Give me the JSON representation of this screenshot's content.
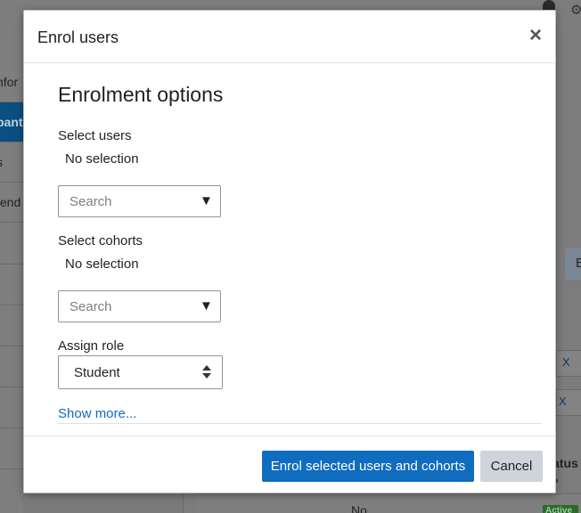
{
  "background": {
    "sidebar": {
      "items": [
        {
          "label": "nfor",
          "active": false
        },
        {
          "label": "pant",
          "active": true
        },
        {
          "label": "s",
          "active": false
        },
        {
          "label": "tend",
          "active": false
        }
      ]
    },
    "bell_icon": "bell-icon",
    "user_icon": "user-icon",
    "filter_remove_labels": [
      "X",
      "X"
    ],
    "button_partial": "E",
    "column_status_partial": "atus",
    "row_value_partial": "No",
    "active_badge": "Active"
  },
  "modal": {
    "title": "Enrol users",
    "close_icon": "close-icon",
    "close_glyph": "×",
    "section_title": "Enrolment options",
    "select_users": {
      "label": "Select users",
      "selection": "No selection",
      "search_placeholder": "Search",
      "arrow_glyph": "▼"
    },
    "select_cohorts": {
      "label": "Select cohorts",
      "selection": "No selection",
      "search_placeholder": "Search",
      "arrow_glyph": "▼"
    },
    "assign_role": {
      "label": "Assign role",
      "selected": "Student"
    },
    "show_more": "Show more...",
    "footer": {
      "primary_label": "Enrol selected users and cohorts",
      "cancel_label": "Cancel"
    }
  },
  "colors": {
    "primary": "#0f6cbf",
    "secondary_button": "#ced4da",
    "text": "#1d2125",
    "backdrop": "#7a7a7a"
  }
}
